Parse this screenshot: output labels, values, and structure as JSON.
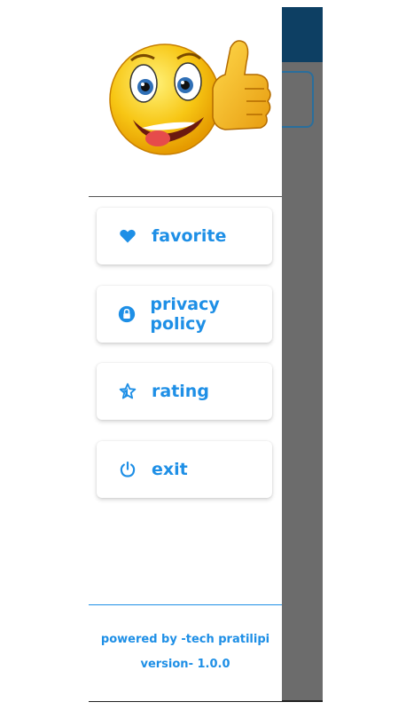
{
  "menu": {
    "items": [
      {
        "label": "favorite",
        "icon": "heart-icon"
      },
      {
        "label": "privacy policy",
        "icon": "lock-icon"
      },
      {
        "label": "rating",
        "icon": "star-icon"
      },
      {
        "label": "exit",
        "icon": "power-icon"
      }
    ]
  },
  "footer": {
    "powered_by": "powered by -tech pratilipi",
    "version": "version- 1.0.0"
  },
  "colors": {
    "accent": "#1e8fe6",
    "appbar": "#0d3f63",
    "scrim": "#6c6c6c"
  }
}
